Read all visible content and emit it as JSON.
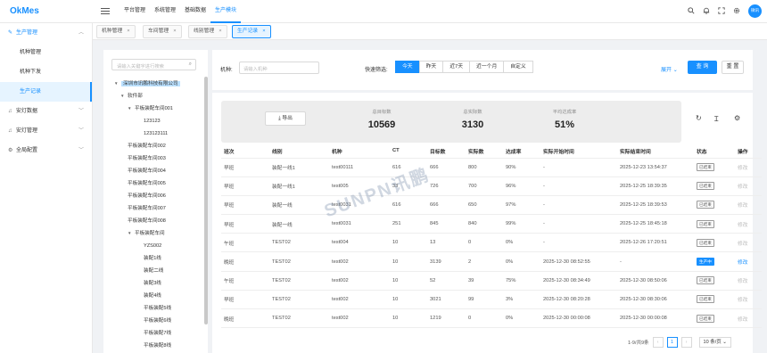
{
  "app": {
    "logo": "OkMes"
  },
  "topnav": [
    "平台管理",
    "系统管理",
    "基础数据",
    "生产模块"
  ],
  "top_icons": [
    "search-icon",
    "bell-icon",
    "fullscreen-icon",
    "settings-icon"
  ],
  "user": {
    "avatar_text": "微讯"
  },
  "sidebar": {
    "groups": [
      {
        "label": "生产管理",
        "icon": "edit-icon",
        "open": true,
        "items": [
          "机种管理",
          "机种下发",
          "生产记录"
        ]
      },
      {
        "label": "安灯数据",
        "icon": "bell-icon"
      },
      {
        "label": "安灯管理",
        "icon": "bell-icon"
      },
      {
        "label": "全局配置",
        "icon": "settings-icon"
      }
    ],
    "active_item": "生产记录"
  },
  "tabs": [
    "机种管理",
    "车间管理",
    "线别管理",
    "生产记录"
  ],
  "active_tab": "生产记录",
  "tree": {
    "placeholder": "请输入关键字进行搜索",
    "nodes": [
      {
        "label": "深圳市讯鹏科技有限公司",
        "level": 0,
        "expanded": true,
        "selected": true
      },
      {
        "label": "软件部",
        "level": 1,
        "expanded": true
      },
      {
        "label": "平板装配车间001",
        "level": 2,
        "expanded": true
      },
      {
        "label": "123123",
        "level": 3
      },
      {
        "label": "123123111",
        "level": 3
      },
      {
        "label": "平板装配车间002",
        "level": 2
      },
      {
        "label": "平板装配车间003",
        "level": 2
      },
      {
        "label": "平板装配车间004",
        "level": 2
      },
      {
        "label": "平板装配车间005",
        "level": 2
      },
      {
        "label": "平板装配车间006",
        "level": 2
      },
      {
        "label": "平板装配车间007",
        "level": 2
      },
      {
        "label": "平板装配车间008",
        "level": 2
      },
      {
        "label": "平板装配车间",
        "level": 2,
        "expanded": true
      },
      {
        "label": "YZS002",
        "level": 3
      },
      {
        "label": "装配1线",
        "level": 3
      },
      {
        "label": "装配二线",
        "level": 3
      },
      {
        "label": "装配3线",
        "level": 3
      },
      {
        "label": "装配4线",
        "level": 3
      },
      {
        "label": "平板装配5线",
        "level": 3
      },
      {
        "label": "平板装配6线",
        "level": 3
      },
      {
        "label": "平板装配7线",
        "level": 3
      },
      {
        "label": "平板装配8线",
        "level": 3
      }
    ]
  },
  "filter": {
    "model_label": "机种:",
    "model_placeholder": "请输入机种",
    "quick_label": "快速筛选:",
    "quick": [
      "今天",
      "昨天",
      "近7天",
      "近一个月",
      "自定义"
    ],
    "quick_active": "今天",
    "expand_label": "展开",
    "query_label": "查 询",
    "reset_label": "重 置"
  },
  "stats": {
    "export_label": "导出",
    "items": [
      {
        "label": "总目标数",
        "value": "10569"
      },
      {
        "label": "总实际数",
        "value": "3130"
      },
      {
        "label": "平均达成率",
        "value": "51%"
      }
    ]
  },
  "table": {
    "columns": [
      "班次",
      "线别",
      "机种",
      "CT",
      "目标数",
      "实际数",
      "达成率",
      "实际开始时间",
      "实际结束时间",
      "状态",
      "操作"
    ],
    "rows": [
      [
        "早班",
        "装配一线1",
        "test00111",
        "616",
        "666",
        "800",
        "90%",
        "-",
        "2025-12-23 13:54:37",
        "已结束",
        "修改"
      ],
      [
        "早班",
        "装配一线1",
        "test005",
        "33",
        "726",
        "700",
        "96%",
        "-",
        "2025-12-25 18:39:35",
        "已结束",
        "修改"
      ],
      [
        "早班",
        "装配一线",
        "test0031",
        "616",
        "666",
        "650",
        "97%",
        "-",
        "2025-12-25 18:39:53",
        "已结束",
        "修改"
      ],
      [
        "早班",
        "装配一线",
        "test0031",
        "251",
        "845",
        "840",
        "99%",
        "-",
        "2025-12-25 18:45:18",
        "已结束",
        "修改"
      ],
      [
        "午班",
        "TEST02",
        "test004",
        "10",
        "13",
        "0",
        "0%",
        "-",
        "2025-12-26 17:20:51",
        "已结束",
        "修改"
      ],
      [
        "晚班",
        "TEST02",
        "test002",
        "10",
        "3139",
        "2",
        "0%",
        "2025-12-30 08:52:55",
        "-",
        "生产中",
        "修改"
      ],
      [
        "午班",
        "TEST02",
        "test002",
        "10",
        "52",
        "39",
        "75%",
        "2025-12-30 08:34:49",
        "2025-12-30 08:50:06",
        "已结束",
        "修改"
      ],
      [
        "早班",
        "TEST02",
        "test002",
        "10",
        "3021",
        "99",
        "3%",
        "2025-12-30 08:20:28",
        "2025-12-30 08:30:06",
        "已结束",
        "修改"
      ],
      [
        "晚班",
        "TEST02",
        "test002",
        "10",
        "1219",
        "0",
        "0%",
        "2025-12-30 00:00:08",
        "2025-12-30 00:00:08",
        "已结束",
        "修改"
      ]
    ]
  },
  "pagination": {
    "summary": "1-9/共9条",
    "current": "1",
    "page_size": "10 条/页"
  },
  "watermark": "SUNPN讯鹏"
}
